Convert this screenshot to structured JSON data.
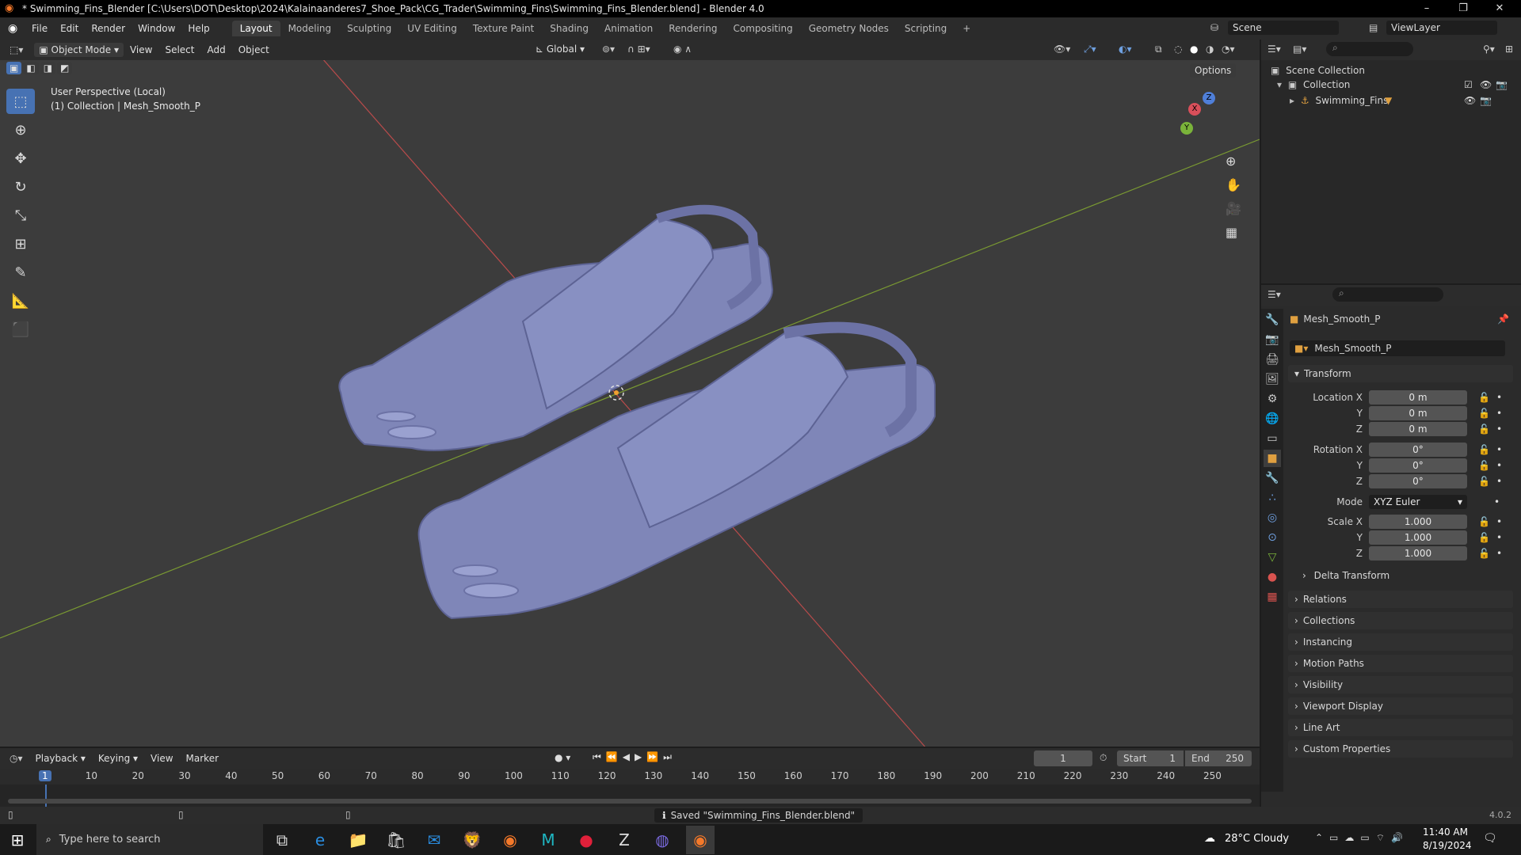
{
  "window": {
    "title": "* Swimming_Fins_Blender [C:\\Users\\DOT\\Desktop\\2024\\Kalainaanderes7_Shoe_Pack\\CG_Trader\\Swimming_Fins\\Swimming_Fins_Blender.blend] - Blender 4.0",
    "minimize": "–",
    "maximize": "❐",
    "close": "✕"
  },
  "menus": [
    "File",
    "Edit",
    "Render",
    "Window",
    "Help"
  ],
  "workspace_tabs": [
    "Layout",
    "Modeling",
    "Sculpting",
    "UV Editing",
    "Texture Paint",
    "Shading",
    "Animation",
    "Rendering",
    "Compositing",
    "Geometry Nodes",
    "Scripting",
    "+"
  ],
  "scene": {
    "label": "Scene",
    "viewlayer": "ViewLayer"
  },
  "viewport_header": {
    "mode": "Object Mode",
    "menus": [
      "View",
      "Select",
      "Add",
      "Object"
    ],
    "orientation": "Global",
    "options": "Options"
  },
  "viewport": {
    "line1": "User Perspective (Local)",
    "line2": "(1) Collection | Mesh_Smooth_P",
    "axis_x": "X",
    "axis_y": "Y",
    "axis_z": "Z"
  },
  "outliner": {
    "root": "Scene Collection",
    "collection": "Collection",
    "object": "Swimming_Fins"
  },
  "properties": {
    "object_name": "Mesh_Smooth_P",
    "data_name": "Mesh_Smooth_P",
    "transform_label": "Transform",
    "location_label": "Location X",
    "y_label": "Y",
    "z_label": "Z",
    "location": [
      "0 m",
      "0 m",
      "0 m"
    ],
    "rotation_label": "Rotation X",
    "rotation": [
      "0°",
      "0°",
      "0°"
    ],
    "mode_label": "Mode",
    "mode": "XYZ Euler",
    "scale_label": "Scale X",
    "scale": [
      "1.000",
      "1.000",
      "1.000"
    ],
    "delta": "Delta Transform",
    "panels": [
      "Relations",
      "Collections",
      "Instancing",
      "Motion Paths",
      "Visibility",
      "Viewport Display",
      "Line Art",
      "Custom Properties"
    ]
  },
  "timeline": {
    "menus": [
      "Playback",
      "Keying",
      "View",
      "Marker"
    ],
    "current_frame": "1",
    "start_label": "Start",
    "start": "1",
    "end_label": "End",
    "end": "250",
    "ticks": [
      "1",
      "10",
      "20",
      "30",
      "40",
      "50",
      "60",
      "70",
      "80",
      "90",
      "100",
      "110",
      "120",
      "130",
      "140",
      "150",
      "160",
      "170",
      "180",
      "190",
      "200",
      "210",
      "220",
      "230",
      "240",
      "250"
    ]
  },
  "status": {
    "message": "Saved \"Swimming_Fins_Blender.blend\"",
    "version": "4.0.2"
  },
  "taskbar": {
    "search_placeholder": "Type here to search",
    "weather": "28°C  Cloudy",
    "time": "11:40 AM",
    "date": "8/19/2024"
  }
}
